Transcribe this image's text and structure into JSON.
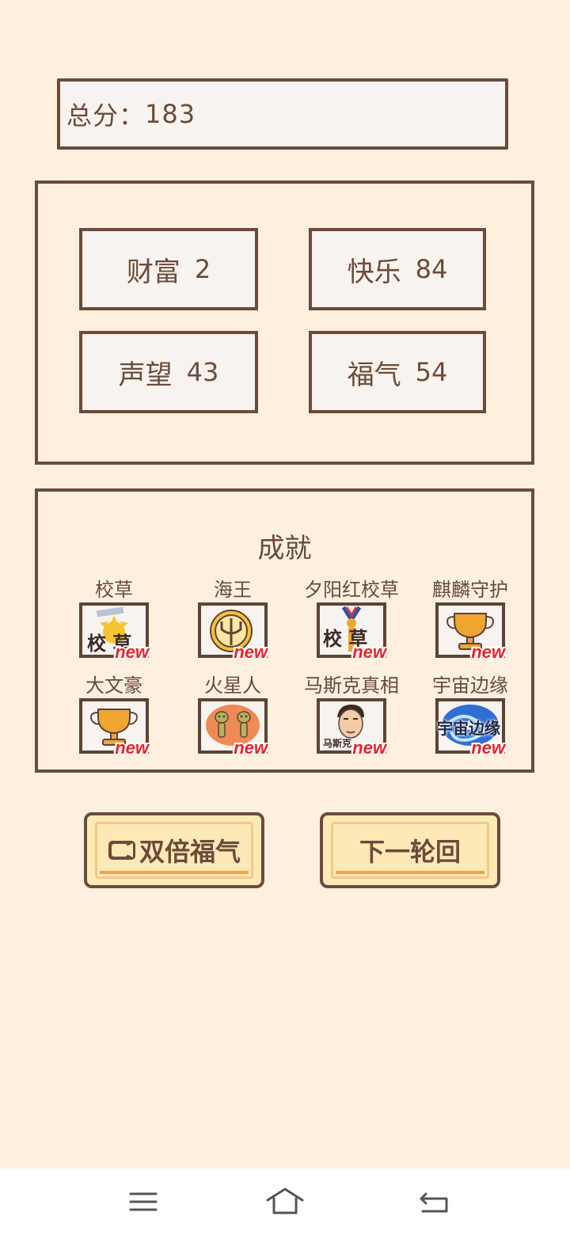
{
  "score": {
    "total_label": "总分：",
    "total_value": "183"
  },
  "stats": [
    {
      "name": "财富",
      "value": "2"
    },
    {
      "name": "快乐",
      "value": "84"
    },
    {
      "name": "声望",
      "value": "43"
    },
    {
      "name": "福气",
      "value": "54"
    }
  ],
  "achievements": {
    "title": "成就",
    "new_label": "new",
    "items": [
      {
        "name": "校草",
        "icon": "campus-star-icon",
        "icon_text": "校 草"
      },
      {
        "name": "海王",
        "icon": "trident-icon"
      },
      {
        "name": "夕阳红校草",
        "icon": "medal-campus-star-icon",
        "icon_text": "校 草"
      },
      {
        "name": "麒麟守护",
        "icon": "trophy-icon"
      },
      {
        "name": "大文豪",
        "icon": "trophy-icon"
      },
      {
        "name": "火星人",
        "icon": "martians-icon"
      },
      {
        "name": "马斯克真相",
        "icon": "portrait-icon",
        "icon_text": "马斯克"
      },
      {
        "name": "宇宙边缘",
        "icon": "galaxy-icon",
        "icon_text": "宇宙边缘"
      }
    ]
  },
  "buttons": {
    "double": "双倍福气",
    "next": "下一轮回"
  },
  "colors": {
    "background": "#fdf0de",
    "border": "#6b4b3a",
    "new_badge": "#e8232a",
    "button_fill": "#fde9b5",
    "trophy": "#f0a531"
  }
}
